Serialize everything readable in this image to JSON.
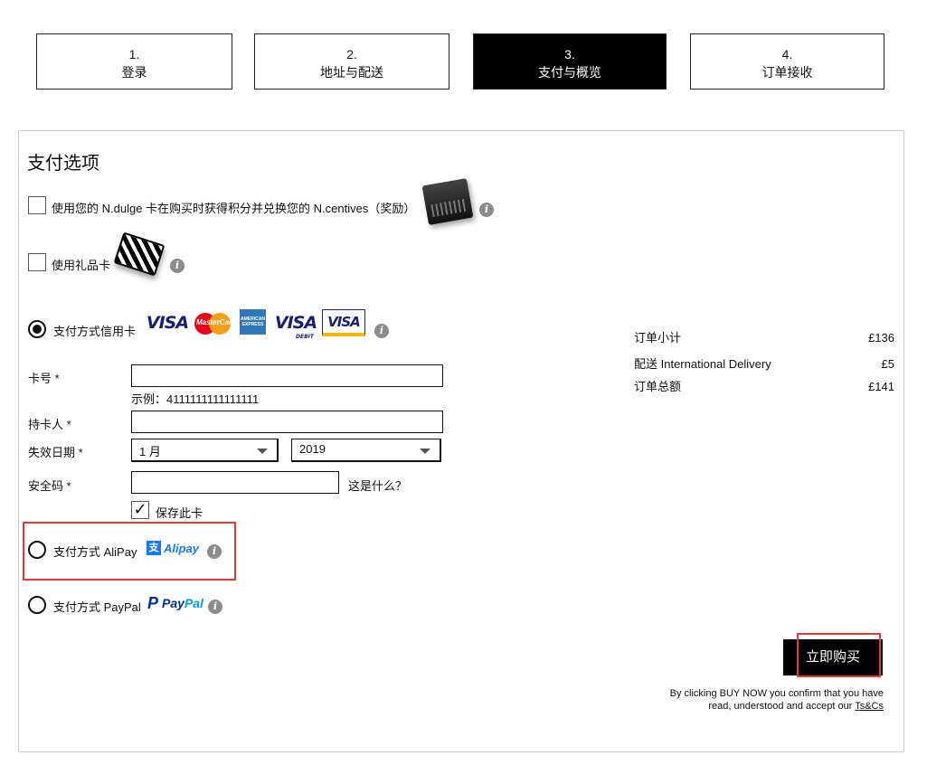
{
  "steps": [
    {
      "num": "1.",
      "label": "登录"
    },
    {
      "num": "2.",
      "label": "地址与配送"
    },
    {
      "num": "3.",
      "label": "支付与概览"
    },
    {
      "num": "4.",
      "label": "订单接收"
    }
  ],
  "payment": {
    "title": "支付选项",
    "ndulge_label": "使用您的 N.dulge 卡在购买时获得积分并兑换您的 N.centives（奖励）",
    "giftcard_label": "使用礼品卡",
    "credit_card_label": "支付方式信用卡",
    "card_logos": {
      "visa": "VISA",
      "mastercard": "MasterCard",
      "amex": "AMERICAN EXPRESS",
      "visa_debit": "VISA",
      "visa_debit_sub": "DEBIT",
      "visa_electron": "VISA"
    },
    "card_number_label": "卡号 *",
    "card_number_value": "",
    "card_example": "示例：4111111111111111",
    "cardholder_label": "持卡人 *",
    "cardholder_value": "",
    "expiry_label": "失效日期 *",
    "expiry_month": "1 月",
    "expiry_year": "2019",
    "cvv_label": "安全码 *",
    "cvv_value": "",
    "cvv_help": "这是什么？",
    "save_card_label": "保存此卡",
    "save_card_checked": "✓",
    "alipay_label": "支付方式 AliPay",
    "alipay_logo": "Alipay",
    "alipay_logo_symbol": "支",
    "paypal_label": "支付方式 PayPal",
    "paypal_logo_1": "Pay",
    "paypal_logo_2": "Pal",
    "paypal_logo_symbol": "P",
    "selected_method": "credit_card"
  },
  "summary": {
    "subtotal_label": "订单小计",
    "subtotal_value": "£136",
    "delivery_label": "配送 International Delivery",
    "delivery_value": "£5",
    "total_label": "订单总额",
    "total_value": "£141"
  },
  "buy_button_label": "立即购买",
  "disclaimer": {
    "line1": "By clicking BUY NOW you confirm that you have",
    "line2": "read, understood and accept our ",
    "link": "Ts&Cs"
  },
  "icons": {
    "info": "i"
  },
  "colors": {
    "accent": "#000000",
    "highlight": "#e53935",
    "alipay": "#1677ff",
    "visa": "#1a1f71"
  }
}
